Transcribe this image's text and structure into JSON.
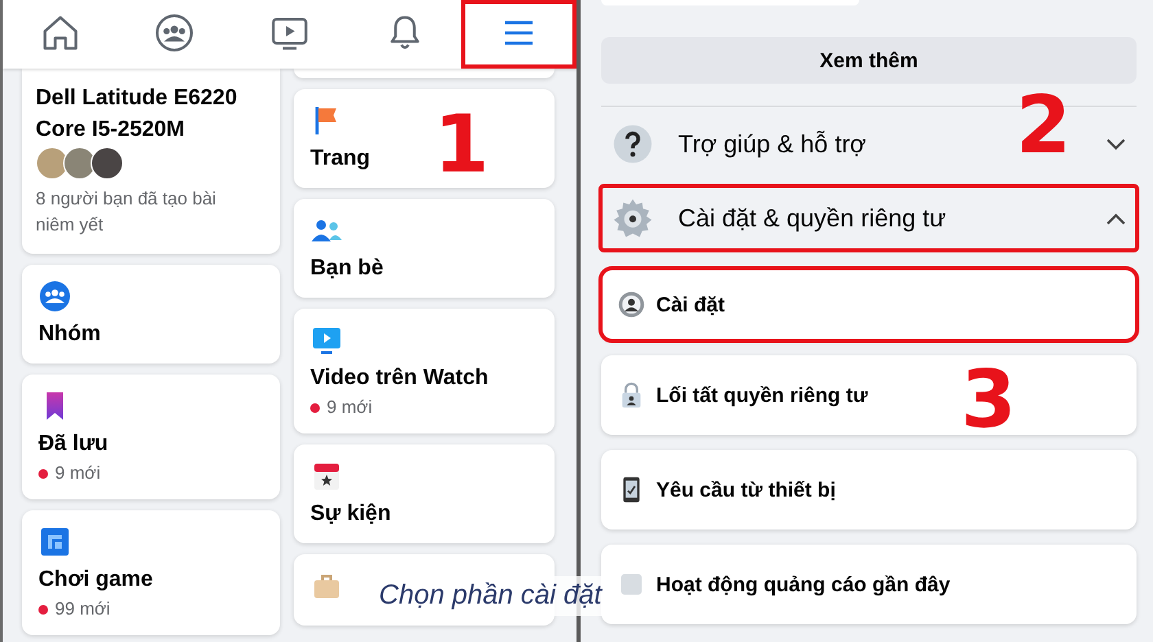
{
  "left_screen": {
    "nav_tabs": [
      {
        "kind": "home",
        "selected": false,
        "highlighted": false
      },
      {
        "kind": "groups",
        "selected": false,
        "highlighted": false
      },
      {
        "kind": "video",
        "selected": false,
        "highlighted": false
      },
      {
        "kind": "notifications",
        "selected": false,
        "highlighted": false
      },
      {
        "kind": "menu",
        "selected": true,
        "highlighted": true
      }
    ],
    "shortcut_columns": [
      [
        {
          "kind": "listing",
          "title_lines": [
            "Dell Latitude E6220",
            "Core I5-2520M"
          ],
          "subtitle": "8 người bạn đã tạo bài niêm yết"
        },
        {
          "kind": "groups",
          "label": "Nhóm"
        },
        {
          "kind": "saved",
          "label": "Đã lưu",
          "badge": "9 mới"
        },
        {
          "kind": "gaming",
          "label": "Chơi game",
          "badge": "99 mới"
        }
      ],
      [
        {
          "kind": "partial"
        },
        {
          "kind": "pages",
          "label": "Trang"
        },
        {
          "kind": "friends",
          "label": "Bạn bè"
        },
        {
          "kind": "watch",
          "label": "Video trên Watch",
          "badge": "9 mới"
        },
        {
          "kind": "events",
          "label": "Sự kiện"
        },
        {
          "kind": "jobs"
        }
      ]
    ]
  },
  "right_screen": {
    "see_more_button": "Xem thêm",
    "sections": [
      {
        "kind": "help",
        "label": "Trợ giúp & hỗ trợ",
        "expanded": false,
        "highlighted": false
      },
      {
        "kind": "settings",
        "label": "Cài đặt & quyền riêng tư",
        "expanded": true,
        "highlighted": true,
        "items": [
          {
            "kind": "account",
            "label": "Cài đặt",
            "highlighted": true
          },
          {
            "kind": "privacy",
            "label": "Lối tất quyền riêng tư",
            "highlighted": false
          },
          {
            "kind": "device",
            "label": "Yêu cầu từ thiết bị",
            "highlighted": false
          },
          {
            "kind": "ads",
            "label": "Hoạt động quảng cáo gần đây",
            "highlighted": false
          }
        ]
      }
    ]
  },
  "step_numbers": [
    "1",
    "2",
    "3"
  ],
  "caption": "Chọn phần cài đặt"
}
